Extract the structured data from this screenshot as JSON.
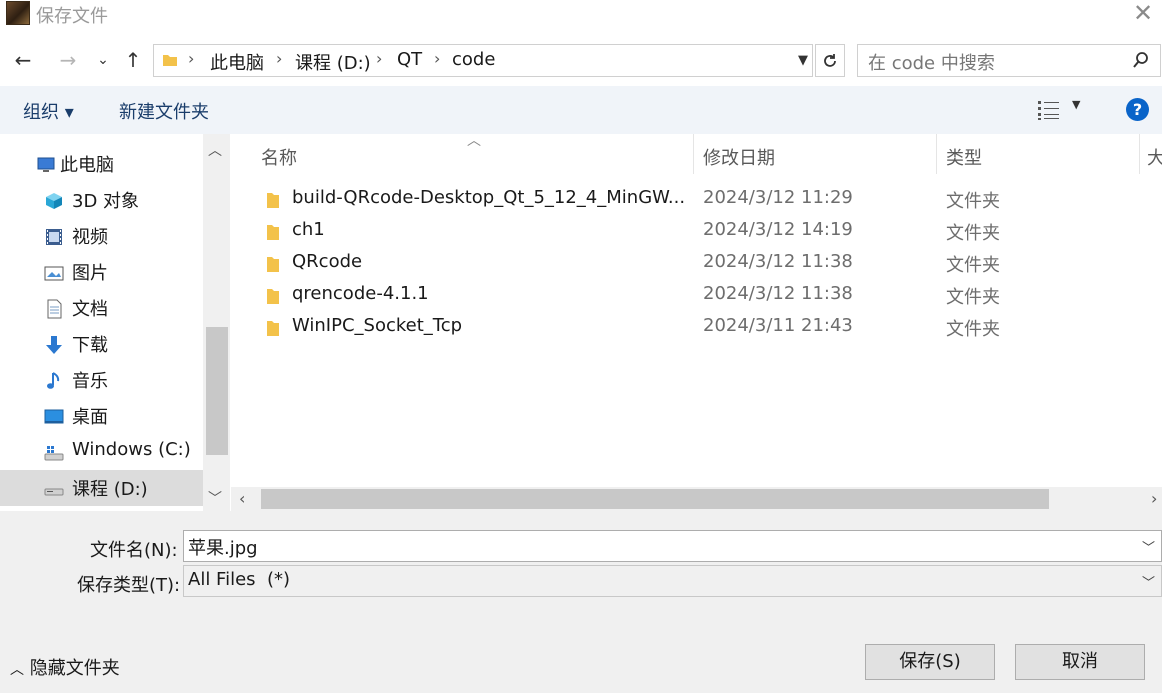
{
  "window": {
    "title": "保存文件",
    "close_glyph": "✕"
  },
  "nav": {
    "back": "←",
    "forward": "→",
    "recent": "⌄",
    "up": "↑",
    "breadcrumbs": [
      "此电脑",
      "课程 (D:)",
      "QT",
      "code"
    ],
    "separator": "›",
    "search_placeholder": "在 code 中搜索"
  },
  "toolbar": {
    "organize": "组织 ▾",
    "new_folder": "新建文件夹",
    "help": "?"
  },
  "sidebar": {
    "items": [
      {
        "label": "此电脑",
        "icon": "pc-icon"
      },
      {
        "label": "3D 对象",
        "icon": "3d-objects-icon"
      },
      {
        "label": "视频",
        "icon": "video-icon"
      },
      {
        "label": "图片",
        "icon": "pictures-icon"
      },
      {
        "label": "文档",
        "icon": "documents-icon"
      },
      {
        "label": "下载",
        "icon": "download-icon"
      },
      {
        "label": "音乐",
        "icon": "music-icon"
      },
      {
        "label": "桌面",
        "icon": "desktop-icon"
      },
      {
        "label": "Windows (C:)",
        "icon": "drive-c-icon"
      },
      {
        "label": "课程 (D:)",
        "icon": "drive-d-icon",
        "selected": true
      }
    ]
  },
  "file_list": {
    "columns": [
      "名称",
      "修改日期",
      "类型",
      "大"
    ],
    "rows": [
      {
        "name": "build-QRcode-Desktop_Qt_5_12_4_MinGW...",
        "date": "2024/3/12 11:29",
        "type": "文件夹"
      },
      {
        "name": "ch1",
        "date": "2024/3/12 14:19",
        "type": "文件夹"
      },
      {
        "name": "QRcode",
        "date": "2024/3/12 11:38",
        "type": "文件夹"
      },
      {
        "name": "qrencode-4.1.1",
        "date": "2024/3/12 11:38",
        "type": "文件夹"
      },
      {
        "name": "WinIPC_Socket_Tcp",
        "date": "2024/3/11 21:43",
        "type": "文件夹"
      }
    ]
  },
  "form": {
    "filename_label": "文件名(N):",
    "filename_value": "苹果.jpg",
    "filetype_label": "保存类型(T):",
    "filetype_value": "All Files  (*)"
  },
  "footer": {
    "hide_folders": "隐藏文件夹",
    "save": "保存(S)",
    "cancel": "取消"
  },
  "colors": {
    "folder": "#f3c24a",
    "help_blue": "#0a64c9",
    "toolbar_bg": "#f0f4f9",
    "link_text": "#1a3d6b"
  }
}
